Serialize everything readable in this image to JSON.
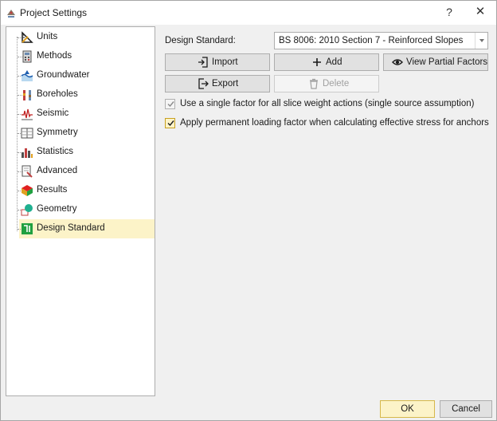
{
  "window": {
    "title": "Project Settings",
    "help_label": "?",
    "close_label": "✕"
  },
  "tree": {
    "items": [
      {
        "label": "Units",
        "icon": "units-icon"
      },
      {
        "label": "Methods",
        "icon": "methods-icon"
      },
      {
        "label": "Groundwater",
        "icon": "groundwater-icon"
      },
      {
        "label": "Boreholes",
        "icon": "boreholes-icon"
      },
      {
        "label": "Seismic",
        "icon": "seismic-icon"
      },
      {
        "label": "Symmetry",
        "icon": "symmetry-icon"
      },
      {
        "label": "Statistics",
        "icon": "statistics-icon"
      },
      {
        "label": "Advanced",
        "icon": "advanced-icon"
      },
      {
        "label": "Results",
        "icon": "results-icon"
      },
      {
        "label": "Geometry",
        "icon": "geometry-icon"
      },
      {
        "label": "Design Standard",
        "icon": "design-standard-icon"
      }
    ],
    "selected": "Design Standard"
  },
  "design_standard": {
    "label": "Design Standard:",
    "value": "BS 8006: 2010 Section 7 - Reinforced Slopes"
  },
  "buttons": {
    "import": "Import",
    "add": "Add",
    "view_partial_factors": "View Partial Factors",
    "export": "Export",
    "delete": "Delete"
  },
  "checkboxes": {
    "single_factor": {
      "label": "Use a single factor for all slice weight actions (single source assumption)",
      "checked": true,
      "enabled": false
    },
    "permanent_loading": {
      "label": "Apply permanent loading factor when calculating effective stress for anchors",
      "checked": true,
      "enabled": true
    }
  },
  "footer": {
    "ok": "OK",
    "cancel": "Cancel"
  },
  "colors": {
    "selection": "#fcf3c8",
    "accent_border": "#d6b84a"
  }
}
